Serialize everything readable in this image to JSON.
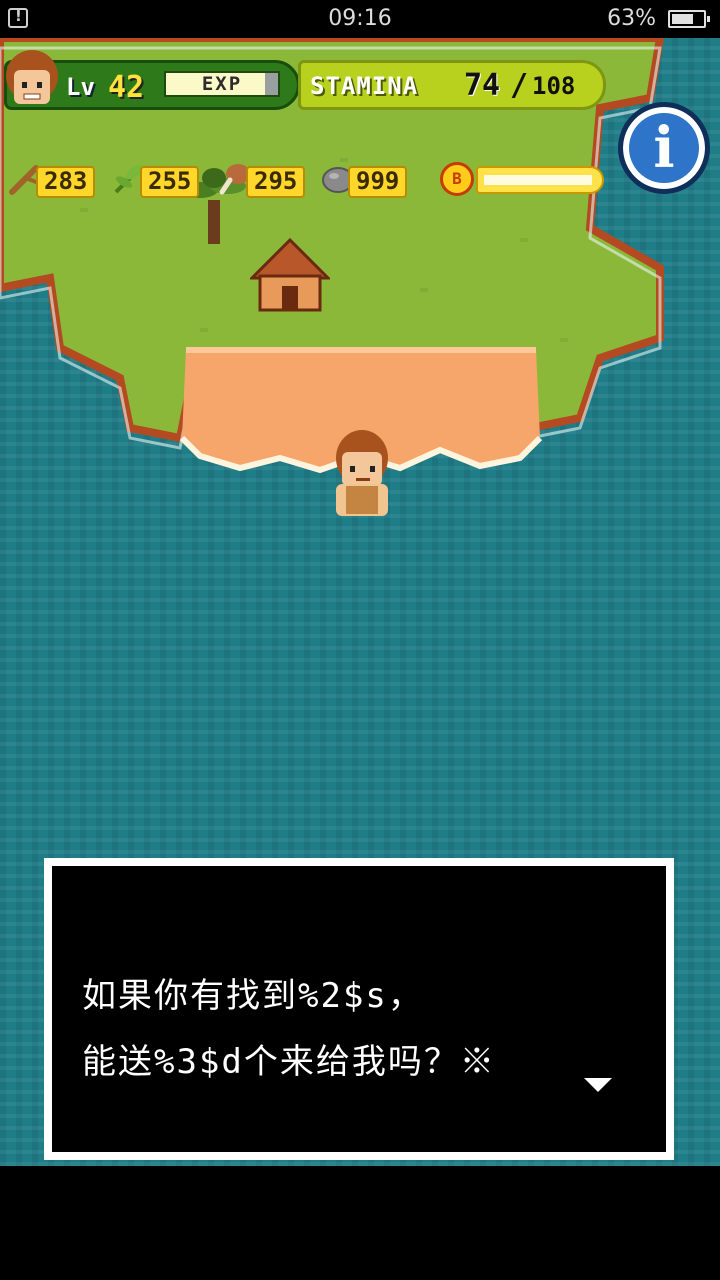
{
  "status_bar": {
    "time": "09:16",
    "battery_percent": "63%",
    "battery_level": 0.63,
    "notification_icon": "notification-icon"
  },
  "hud": {
    "level_label": "Lv",
    "level_value": "42",
    "exp_label": "EXP",
    "exp_progress": 0.88,
    "stamina_label": "STAMINA",
    "stamina_current": "74",
    "stamina_separator": "/",
    "stamina_max": "108",
    "info_glyph": "i",
    "bonus_glyph": "B"
  },
  "resources": [
    {
      "icon": "wood-stick-icon",
      "value": "283"
    },
    {
      "icon": "herb-leaf-icon",
      "value": "255"
    },
    {
      "icon": "meat-drumstick-icon",
      "value": "295"
    },
    {
      "icon": "stone-icon",
      "value": "999"
    }
  ],
  "dialog": {
    "line1": "如果你有找到%2$s，",
    "line2": "能送%3$d个来给我吗？※"
  },
  "colors": {
    "ocean": "#1f7d88",
    "grass": "#8cb83a",
    "sand": "#f6a66a",
    "hud_green": "#2e7a1a",
    "stamina_green": "#b7d11e",
    "resource_yellow": "#ffd62a",
    "info_blue": "#2e74c8"
  }
}
